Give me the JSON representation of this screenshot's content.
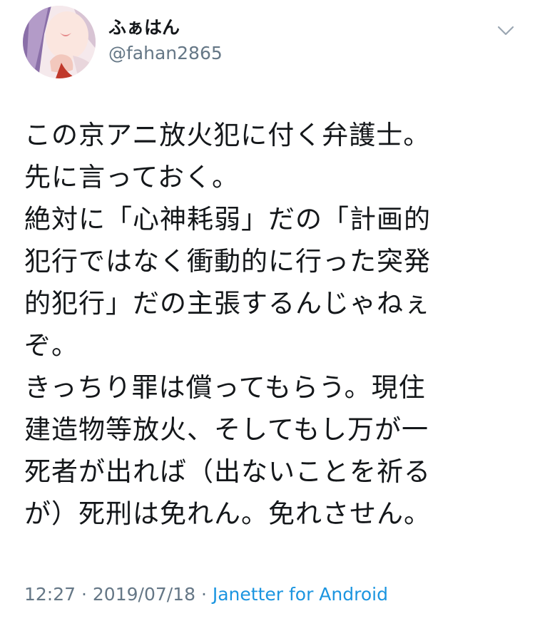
{
  "tweet": {
    "display_name": "ふぁはん",
    "handle": "@fahan2865",
    "text_lines": [
      "この京アニ放火犯に付く弁護士。",
      "先に言っておく。",
      "絶対に「心神耗弱」だの「計画的",
      "犯行ではなく衝動的に行った突発",
      "的犯行」だの主張するんじゃねぇ",
      "ぞ。",
      "きっちり罪は償ってもらう。現住",
      "建造物等放火、そしてもし万が一",
      "死者が出れば（出ないことを祈る",
      "が）死刑は免れん。免れさせん。"
    ],
    "time": "12:27",
    "date": "2019/07/18",
    "separator": "·",
    "source": "Janetter for Android"
  },
  "icons": {
    "avatar": "avatar-image",
    "menu": "chevron-down-icon"
  },
  "colors": {
    "text": "#14171a",
    "secondary": "#657786",
    "link": "#1b95e0"
  }
}
